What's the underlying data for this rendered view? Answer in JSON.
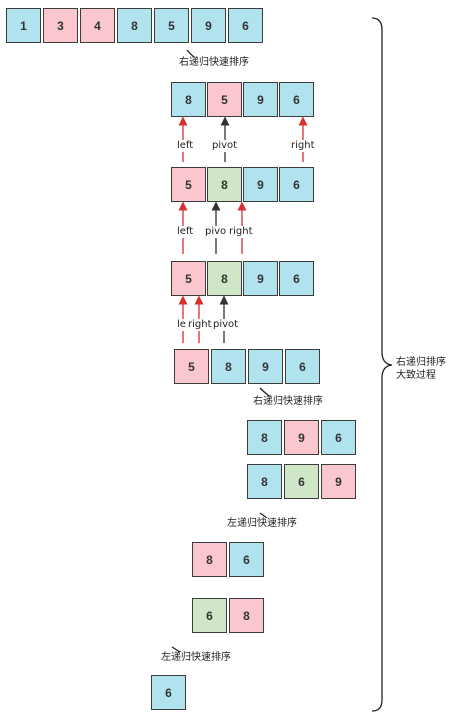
{
  "colors": {
    "blue": "#b1e3ee",
    "pink": "#f9c7cd",
    "green": "#cfe6c8",
    "arrow_red": "#d63030",
    "arrow_dark": "#333333"
  },
  "rows": [
    {
      "cells": [
        {
          "v": "1",
          "c": "blue"
        },
        {
          "v": "3",
          "c": "pink"
        },
        {
          "v": "4",
          "c": "pink"
        },
        {
          "v": "8",
          "c": "blue"
        },
        {
          "v": "5",
          "c": "blue"
        },
        {
          "v": "9",
          "c": "blue"
        },
        {
          "v": "6",
          "c": "blue"
        }
      ]
    },
    {
      "cells": [
        {
          "v": "8",
          "c": "blue"
        },
        {
          "v": "5",
          "c": "pink"
        },
        {
          "v": "9",
          "c": "blue"
        },
        {
          "v": "6",
          "c": "blue"
        }
      ]
    },
    {
      "cells": [
        {
          "v": "5",
          "c": "pink"
        },
        {
          "v": "8",
          "c": "green"
        },
        {
          "v": "9",
          "c": "blue"
        },
        {
          "v": "6",
          "c": "blue"
        }
      ]
    },
    {
      "cells": [
        {
          "v": "5",
          "c": "pink"
        },
        {
          "v": "8",
          "c": "green"
        },
        {
          "v": "9",
          "c": "blue"
        },
        {
          "v": "6",
          "c": "blue"
        }
      ]
    },
    {
      "cells": [
        {
          "v": "5",
          "c": "pink"
        },
        {
          "v": "8",
          "c": "blue"
        },
        {
          "v": "9",
          "c": "blue"
        },
        {
          "v": "6",
          "c": "blue"
        }
      ]
    },
    {
      "cells": [
        {
          "v": "8",
          "c": "blue"
        },
        {
          "v": "9",
          "c": "pink"
        },
        {
          "v": "6",
          "c": "blue"
        }
      ]
    },
    {
      "cells": [
        {
          "v": "8",
          "c": "blue"
        },
        {
          "v": "6",
          "c": "green"
        },
        {
          "v": "9",
          "c": "pink"
        }
      ]
    },
    {
      "cells": [
        {
          "v": "8",
          "c": "pink"
        },
        {
          "v": "6",
          "c": "blue"
        }
      ]
    },
    {
      "cells": [
        {
          "v": "6",
          "c": "green"
        },
        {
          "v": "8",
          "c": "pink"
        }
      ]
    },
    {
      "cells": [
        {
          "v": "6",
          "c": "blue"
        }
      ]
    }
  ],
  "step_labels": [
    "右递归快速排序",
    "右递归快速排序",
    "左递归快速排序",
    "左递归快速排序"
  ],
  "pointers": {
    "left": "left",
    "right": "right",
    "pivot": "pivot",
    "pivo": "pivo",
    "le": "le"
  },
  "brace_label": [
    "右递归排序",
    "大致过程"
  ]
}
